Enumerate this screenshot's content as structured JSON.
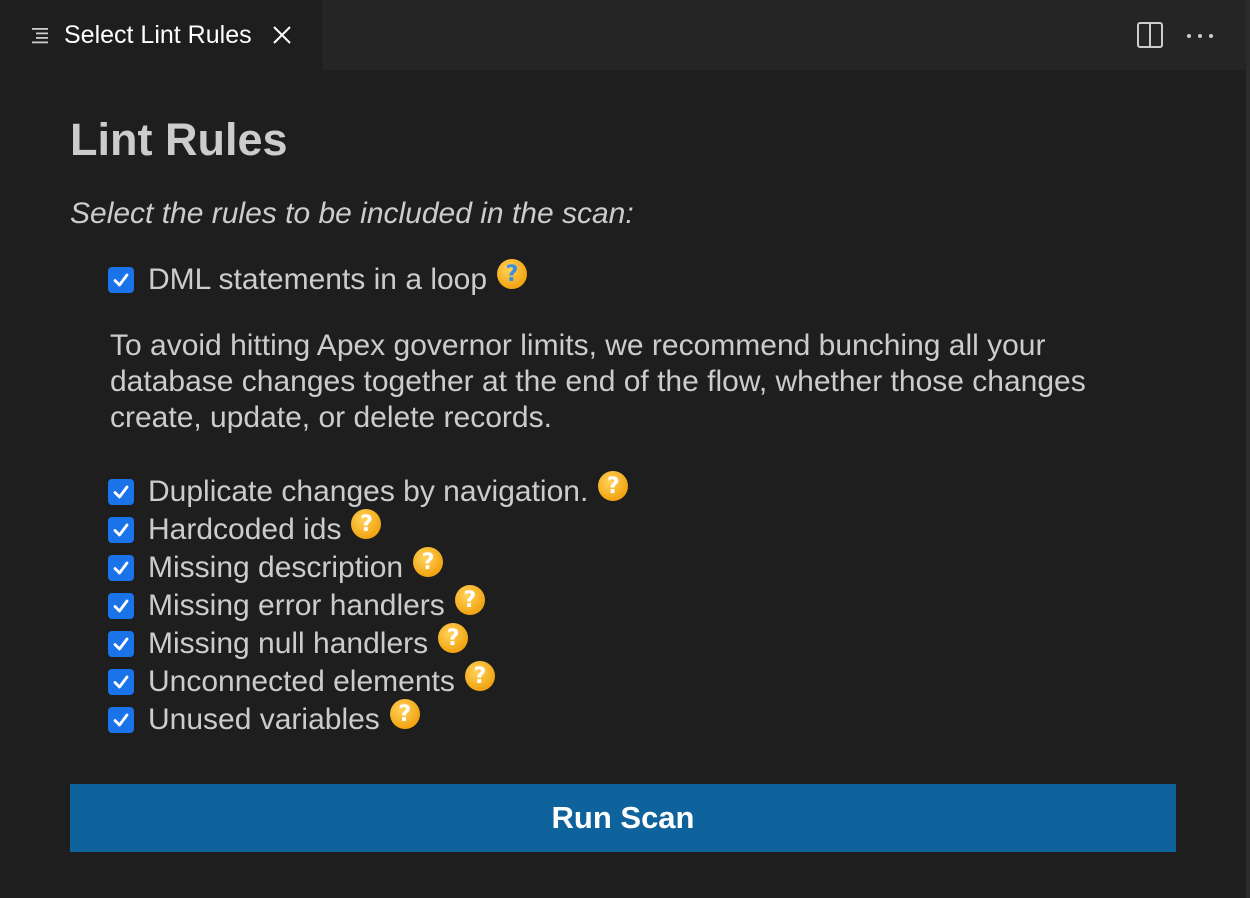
{
  "tab": {
    "title": "Select Lint Rules"
  },
  "heading": "Lint Rules",
  "subtitle": "Select the rules to be included in the scan:",
  "help_glyph": "?",
  "rules": [
    {
      "label": "DML statements in a loop",
      "checked": true
    },
    {
      "label": "Duplicate changes by navigation.",
      "checked": true
    },
    {
      "label": "Hardcoded ids",
      "checked": true
    },
    {
      "label": "Missing description",
      "checked": true
    },
    {
      "label": "Missing error handlers",
      "checked": true
    },
    {
      "label": "Missing null handlers",
      "checked": true
    },
    {
      "label": "Unconnected elements",
      "checked": true
    },
    {
      "label": "Unused variables",
      "checked": true
    }
  ],
  "description": "To avoid hitting Apex governor limits, we recommend bunching all your database changes together at the end of the flow, whether those changes create, update, or delete records.",
  "run_button": "Run Scan",
  "colors": {
    "background": "#1e1e1e",
    "checkbox": "#1a73e8",
    "button": "#0e639c",
    "help_icon": "#f2a413"
  },
  "icons": {
    "tab": "preview-list-icon",
    "close": "close-icon",
    "split": "split-editor-icon",
    "more": "more-actions-icon",
    "help": "help-icon"
  }
}
